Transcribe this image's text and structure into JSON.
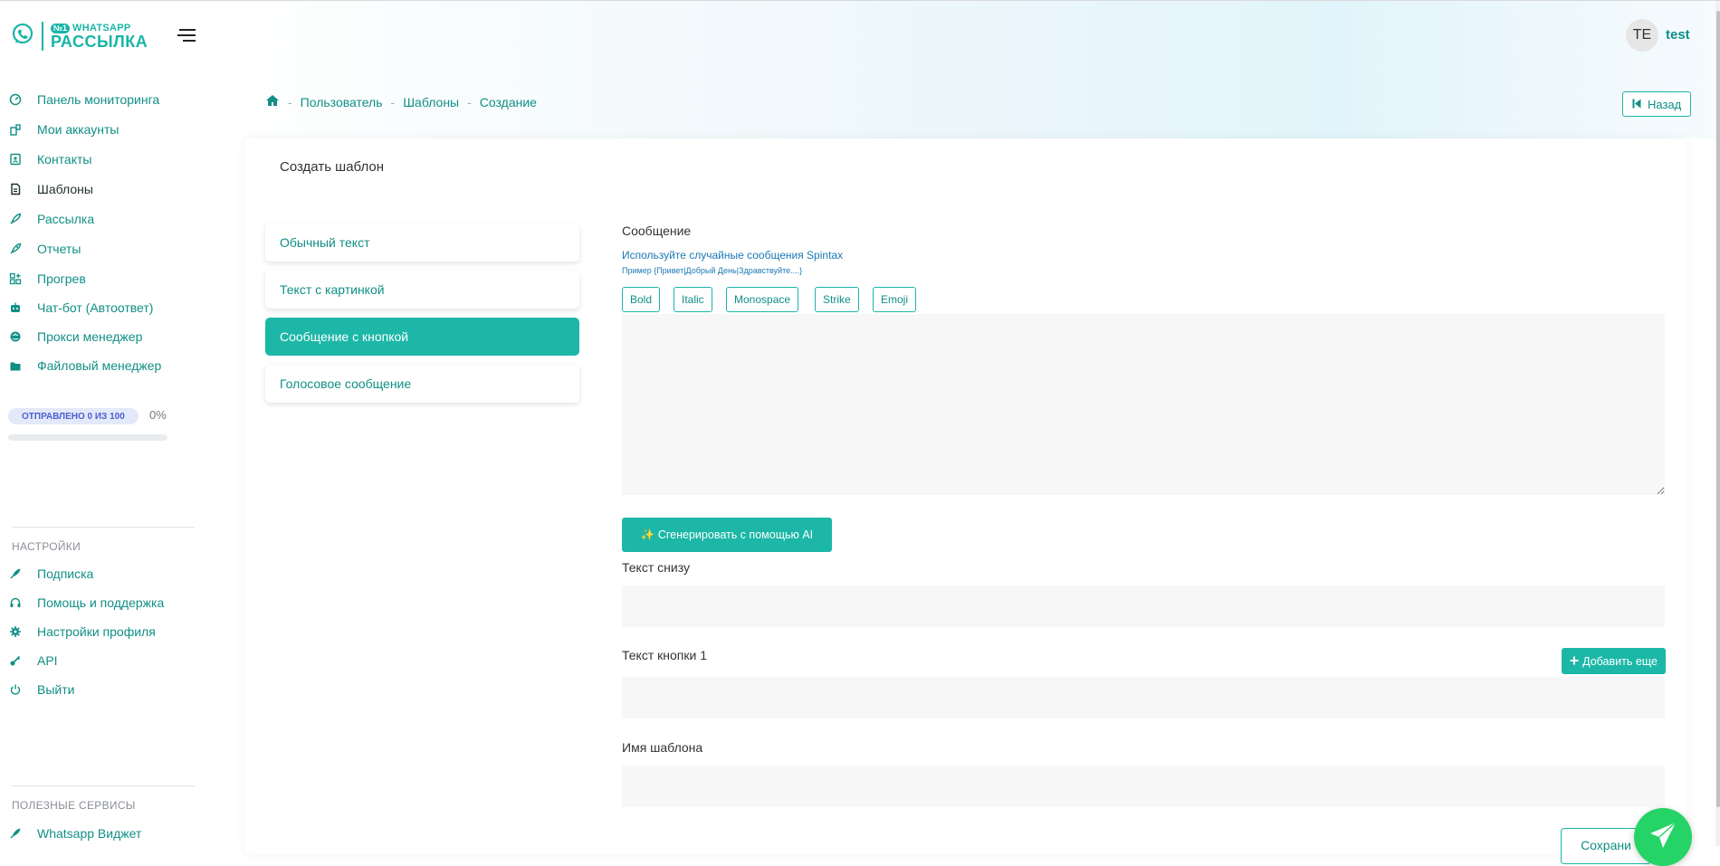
{
  "brand": {
    "line1": "WHATSAPP",
    "line2": "РАССЫЛКА",
    "badge": "№1"
  },
  "user": {
    "initials": "TE",
    "name": "test"
  },
  "sidebar": {
    "items": [
      {
        "label": "Панель мониторинга",
        "icon": "gauge-icon"
      },
      {
        "label": "Мои аккаунты",
        "icon": "accounts-icon"
      },
      {
        "label": "Контакты",
        "icon": "contact-card-icon"
      },
      {
        "label": "Шаблоны",
        "icon": "template-icon"
      },
      {
        "label": "Рассылка",
        "icon": "rocket-icon"
      },
      {
        "label": "Отчеты",
        "icon": "rocket-report-icon"
      },
      {
        "label": "Прогрев",
        "icon": "grid-plus-icon"
      },
      {
        "label": "Чат-бот (Автоответ)",
        "icon": "robot-icon"
      },
      {
        "label": "Прокси менеджер",
        "icon": "globe-icon"
      },
      {
        "label": "Файловый менеджер",
        "icon": "folder-icon"
      }
    ],
    "active_index": 3,
    "sent": {
      "label": "ОТПРАВЛЕНО 0 ИЗ 100",
      "percent_text": "0%",
      "percent": 0
    },
    "settings_title": "НАСТРОЙКИ",
    "settings_items": [
      {
        "label": "Подписка",
        "icon": "rocket-icon"
      },
      {
        "label": "Помощь и поддержка",
        "icon": "headset-icon"
      },
      {
        "label": "Настройки профиля",
        "icon": "gear-icon"
      },
      {
        "label": "API",
        "icon": "key-icon"
      },
      {
        "label": "Выйти",
        "icon": "power-icon"
      }
    ],
    "services_title": "ПОЛЕЗНЫЕ СЕРВИСЫ",
    "services_items": [
      {
        "label": "Whatsapp Виджет",
        "icon": "rocket-icon"
      }
    ]
  },
  "breadcrumb": {
    "items": [
      "Пользователь",
      "Шаблоны",
      "Создание"
    ],
    "home_icon": "home-icon"
  },
  "back_button": {
    "label": "Назад",
    "icon": "skip-back-icon"
  },
  "card": {
    "title": "Создать шаблон"
  },
  "template_types": [
    {
      "label": "Обычный текст"
    },
    {
      "label": "Текст с картинкой"
    },
    {
      "label": "Сообщение с кнопкой"
    },
    {
      "label": "Голосовое сообщение"
    }
  ],
  "active_type": 2,
  "form": {
    "message_label": "Сообщение",
    "spintax_hint": "Используйте случайные сообщения Spintax",
    "spintax_example": "Пример {Привет|Добрый День|Здравствуйте....}",
    "format_buttons": [
      "Bold",
      "Italic",
      "Monospace",
      "Strike",
      "Emoji"
    ],
    "message_value": "",
    "ai_button": "✨ Сгенерировать с помощью AI",
    "footer_label": "Текст снизу",
    "footer_value": "",
    "button_text_label": "Текст кнопки 1",
    "add_more": "Добавить еще",
    "button_text_value": "",
    "template_name_label": "Имя шаблона",
    "template_name_value": "",
    "save_button": "Сохрани"
  },
  "colors": {
    "accent": "#1cb7a7",
    "link": "#108f86",
    "whatsapp": "#25d366"
  }
}
